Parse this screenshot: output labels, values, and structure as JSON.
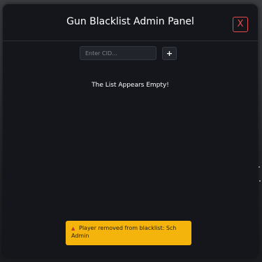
{
  "panel": {
    "title": "Gun Blacklist Admin Panel",
    "close_label": "X"
  },
  "form": {
    "cid_placeholder": "Enter CID...",
    "cid_value": "",
    "add_label": "+"
  },
  "list": {
    "empty_message": "The List Appears Empty!"
  },
  "toast": {
    "icon": "warning-icon",
    "message": "Player removed from blacklist: Sch Admin",
    "color": "#f5b40b"
  },
  "colors": {
    "panel_bg": "#14161c",
    "close_accent": "#e24c4c"
  }
}
